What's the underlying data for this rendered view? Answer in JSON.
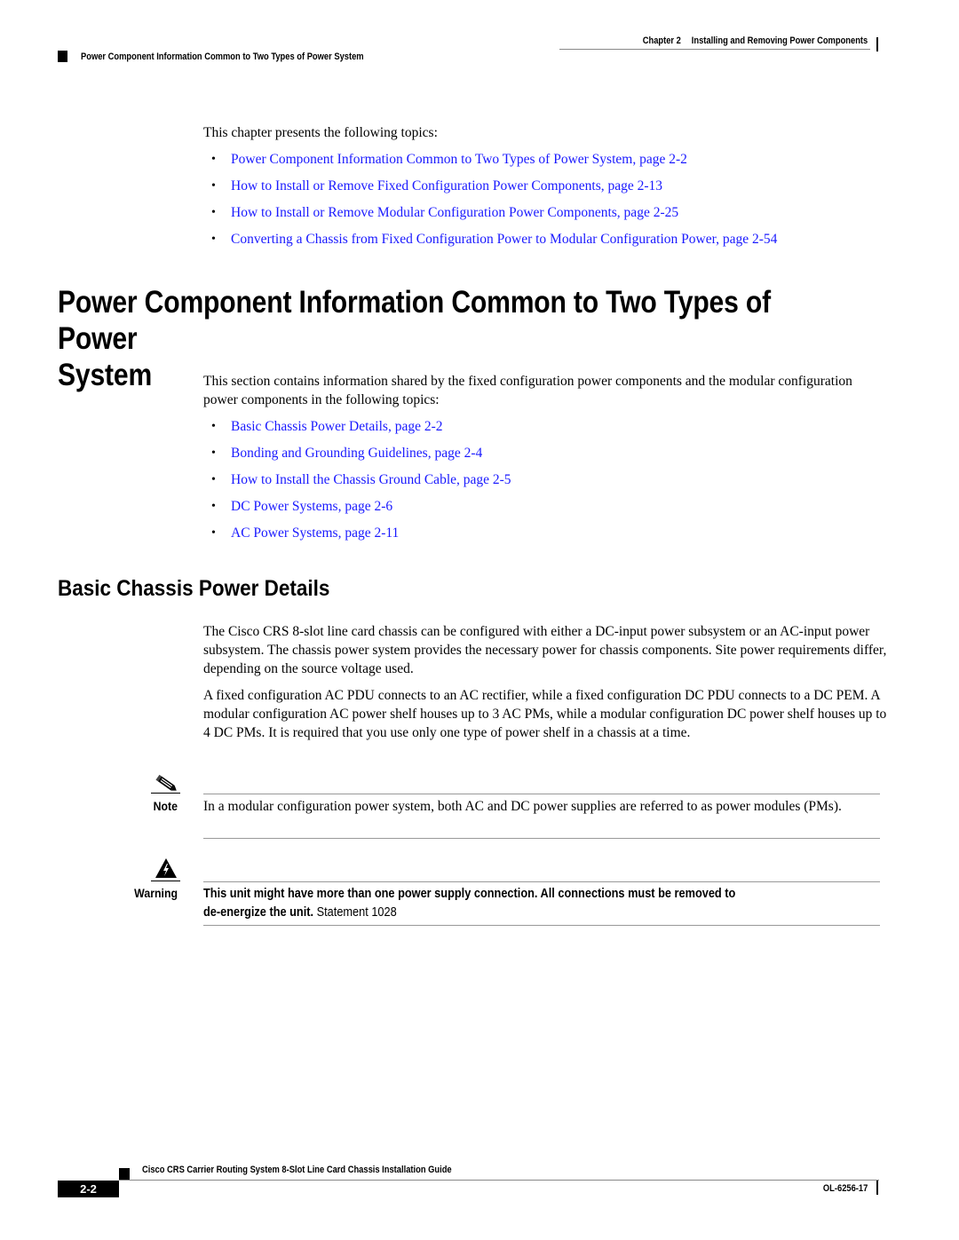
{
  "header": {
    "chapter_label": "Chapter 2",
    "chapter_title": "Installing and Removing Power Components",
    "section_title": "Power Component Information Common to Two Types of Power System"
  },
  "intro": {
    "text": "This chapter presents the following topics:",
    "topics": [
      "Power Component Information Common to Two Types of Power System, page 2-2",
      "How to Install or Remove Fixed Configuration Power Components, page 2-13",
      "How to Install or Remove Modular Configuration Power Components, page 2-25",
      "Converting a Chassis from Fixed Configuration Power to Modular Configuration Power, page 2-54"
    ]
  },
  "section": {
    "heading_line1": "Power Component Information Common to Two Types of Power",
    "heading_line2": "System",
    "text": "This section contains information shared by the fixed configuration power components and the modular configuration power components in the following topics:",
    "topics": [
      "Basic Chassis Power Details, page 2-2",
      "Bonding and Grounding Guidelines, page 2-4",
      "How to Install the Chassis Ground Cable, page 2-5",
      "DC Power Systems, page 2-6",
      "AC Power Systems, page 2-11"
    ]
  },
  "subsection": {
    "heading": "Basic Chassis Power Details",
    "paragraph1": "The Cisco CRS 8-slot line card chassis can be configured with either a DC-input power subsystem or an AC-input power subsystem. The chassis power system provides the necessary power for chassis components. Site power requirements differ, depending on the source voltage used.",
    "paragraph2": "A fixed configuration AC PDU connects to an AC rectifier, while a fixed configuration DC PDU connects to a DC PEM. A modular configuration AC power shelf houses up to 3 AC PMs, while a modular configuration DC power shelf houses up to 4 DC PMs. It is required that you use only one type of power shelf in a chassis at a time."
  },
  "note": {
    "icon": "pencil-icon",
    "label": "Note",
    "text": "In a modular configuration power system, both AC and DC power supplies are referred to as power modules (PMs)."
  },
  "warning": {
    "icon": "electrical-hazard-icon",
    "label": "Warning",
    "bold_line1": "This unit might have more than one power supply connection. All connections must be removed to",
    "bold_line2": "de-energize the unit.",
    "statement": " Statement 1028"
  },
  "footer": {
    "guide_title": "Cisco CRS Carrier Routing System 8-Slot Line Card Chassis Installation Guide",
    "page_number": "2-2",
    "doc_id": "OL-6256-17"
  },
  "colors": {
    "link": "#1a1aff",
    "text": "#000000",
    "rule": "#999999"
  }
}
